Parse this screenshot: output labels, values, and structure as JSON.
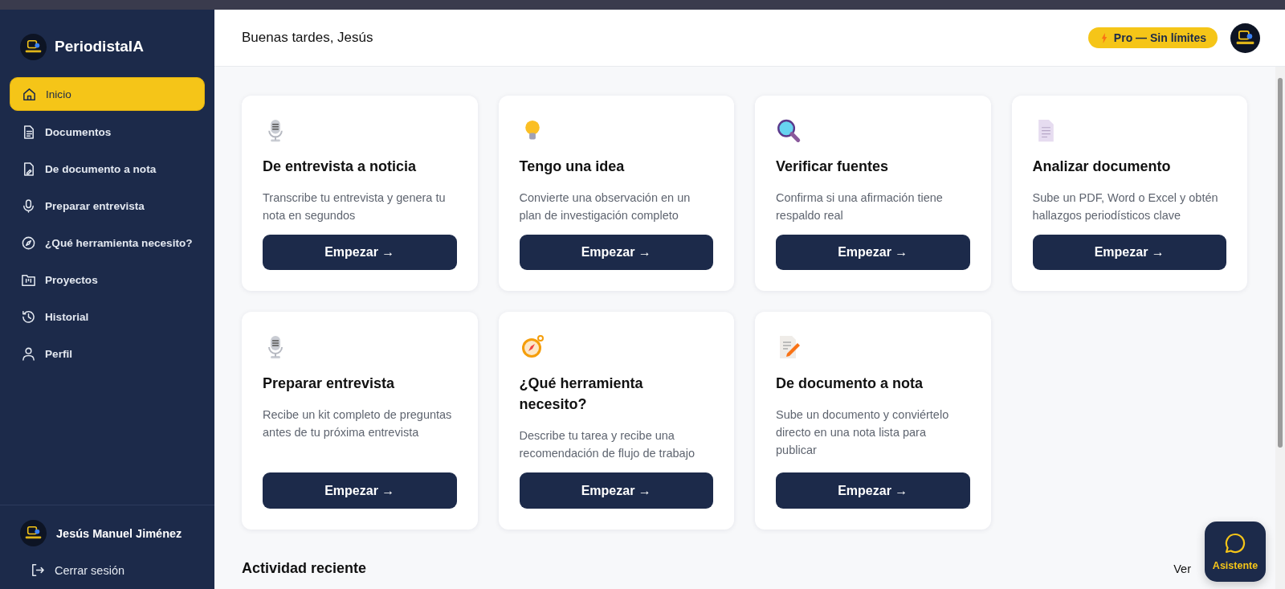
{
  "sidebar": {
    "brand": "PeriodistaIA",
    "items": [
      {
        "label": "Inicio",
        "selected": true
      },
      {
        "label": "Documentos",
        "selected": false
      },
      {
        "label": "De documento a nota",
        "selected": false
      },
      {
        "label": "Preparar entrevista",
        "selected": false
      },
      {
        "label": "¿Qué herramienta necesito?",
        "selected": false
      },
      {
        "label": "Proyectos",
        "selected": false
      },
      {
        "label": "Historial",
        "selected": false
      },
      {
        "label": "Perfil",
        "selected": false
      }
    ],
    "user": "Jesús Manuel Jiménez",
    "logout": "Cerrar sesión"
  },
  "header": {
    "greeting": "Buenas tardes, Jesús",
    "plan_badge": "Pro — Sin límites"
  },
  "tools": [
    {
      "title": "De entrevista a noticia",
      "description": "Transcribe tu entrevista y genera tu nota en segundos",
      "button": "Empezar →"
    },
    {
      "title": "Tengo una idea",
      "description": "Convierte una observación en un plan de investigación completo",
      "button": "Empezar →"
    },
    {
      "title": "Verificar fuentes",
      "description": "Confirma si una afirmación tiene respaldo real",
      "button": "Empezar →"
    },
    {
      "title": "Analizar documento",
      "description": "Sube un PDF, Word o Excel y obtén hallazgos periodísticos clave",
      "button": "Empezar →"
    },
    {
      "title": "Preparar entrevista",
      "description": "Recibe un kit completo de preguntas antes de tu próxima entrevista",
      "button": "Empezar →"
    },
    {
      "title": "¿Qué herramienta necesito?",
      "description": "Describe tu tarea y recibe una recomendación de flujo de trabajo",
      "button": "Empezar →"
    },
    {
      "title": "De documento a nota",
      "description": "Sube un documento y conviértelo directo en una nota lista para publicar",
      "button": "Empezar →"
    }
  ],
  "recent_activity": {
    "title": "Actividad reciente",
    "link": "Ver"
  },
  "assistant_button": "Asistente"
}
